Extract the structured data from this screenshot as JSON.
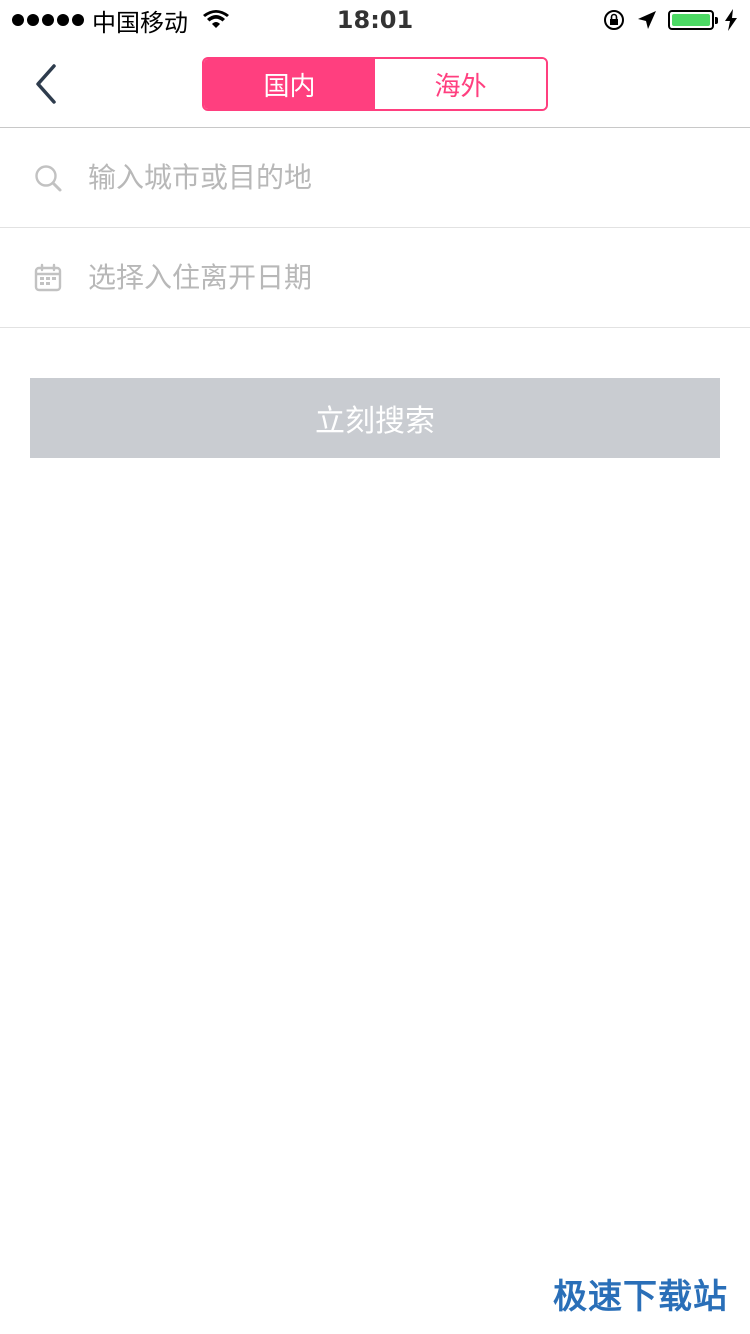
{
  "status_bar": {
    "carrier": "中国移动",
    "time": "18:01",
    "battery_color": "#4cd964"
  },
  "nav": {
    "back_icon": "chevron-left-icon",
    "tabs": [
      {
        "label": "国内",
        "active": true
      },
      {
        "label": "海外",
        "active": false
      }
    ],
    "accent_color": "#ff3f7f"
  },
  "search_row": {
    "icon": "search-icon",
    "placeholder": "输入城市或目的地",
    "value": ""
  },
  "date_row": {
    "icon": "calendar-icon",
    "placeholder": "选择入住离开日期",
    "value": ""
  },
  "search_button": {
    "label": "立刻搜索",
    "color": "#c9ccd1"
  },
  "watermark": {
    "text": "极速下载站"
  }
}
